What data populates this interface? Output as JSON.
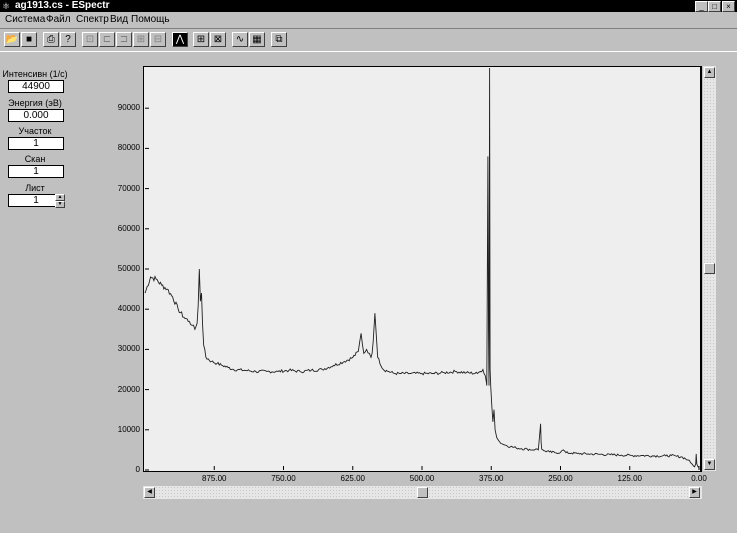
{
  "window": {
    "title": "ag1913.cs - ESpectr"
  },
  "menu": [
    "Система",
    "Файл",
    "Спектр",
    "Вид",
    "Помощь"
  ],
  "fields": {
    "intensity_label": "Интенсивн (1/с)",
    "intensity_value": "44900",
    "energy_label": "Энергия (эВ)",
    "energy_value": "0.000",
    "region_label": "Участок",
    "region_value": "1",
    "scan_label": "Скан",
    "scan_value": "1",
    "sheet_label": "Лист",
    "sheet_value": "1"
  },
  "icons": {
    "toolbar": [
      "open-folder-icon",
      "save-icon",
      "print-icon",
      "help-icon",
      "tool-1-icon",
      "tool-2-icon",
      "tool-3-icon",
      "tool-4-icon",
      "tool-5-icon",
      "peak-icon",
      "grid-icon",
      "grid-zoom-icon",
      "spectrum-icon",
      "spectrum-grid-icon",
      "export-icon"
    ]
  },
  "colors": {
    "plot_bg": "#eeeeee",
    "line": "#202020",
    "window_bg": "#c0c0c0"
  },
  "chart_data": {
    "type": "line",
    "title": "",
    "xlabel": "",
    "ylabel": "",
    "xlim": [
      1000,
      0
    ],
    "ylim": [
      0,
      100000
    ],
    "x_reversed": true,
    "x_ticks": [
      875,
      750,
      625,
      500,
      375,
      250,
      125,
      0
    ],
    "x_tick_labels": [
      "875.00",
      "750.00",
      "625.00",
      "500.00",
      "375.00",
      "250.00",
      "125.00",
      "0.00"
    ],
    "y_ticks": [
      0,
      10000,
      20000,
      30000,
      40000,
      50000,
      60000,
      70000,
      80000,
      90000
    ],
    "y_tick_labels": [
      "0",
      "10000",
      "20000",
      "30000",
      "40000",
      "50000",
      "60000",
      "70000",
      "80000",
      "90000"
    ],
    "series": [
      {
        "x": [
          1000,
          990,
          980,
          970,
          960,
          950,
          940,
          930,
          920,
          915,
          910,
          906,
          904,
          902,
          900,
          898,
          896,
          894,
          892,
          890,
          880,
          870,
          860,
          850,
          840,
          820,
          800,
          780,
          760,
          740,
          720,
          700,
          680,
          660,
          640,
          625,
          615,
          610,
          605,
          600,
          595,
          592,
          590,
          588,
          585,
          580,
          570,
          560,
          550,
          540,
          520,
          500,
          480,
          460,
          440,
          420,
          400,
          395,
          390,
          386,
          384,
          383,
          382,
          381,
          380,
          379,
          378,
          377,
          376,
          374,
          372,
          370,
          368,
          365,
          360,
          355,
          350,
          340,
          330,
          320,
          310,
          300,
          295,
          290,
          288,
          286,
          285,
          284,
          282,
          280,
          270,
          260,
          250,
          245,
          240,
          230,
          220,
          200,
          180,
          160,
          140,
          120,
          100,
          80,
          60,
          50,
          40,
          30,
          20,
          15,
          10,
          8,
          6,
          5,
          4,
          2,
          0
        ],
        "y": [
          44000,
          48000,
          47500,
          46000,
          45000,
          43000,
          40000,
          38000,
          37000,
          36000,
          35000,
          36500,
          41000,
          50000,
          42000,
          44000,
          36000,
          31000,
          30000,
          28000,
          27000,
          26500,
          26000,
          25500,
          25000,
          24800,
          24500,
          24500,
          24500,
          24800,
          24500,
          24800,
          25000,
          26000,
          27000,
          28000,
          29500,
          34000,
          29000,
          30000,
          29000,
          28000,
          29000,
          32000,
          39000,
          28000,
          25000,
          24500,
          24000,
          24000,
          24000,
          24000,
          24000,
          24200,
          24500,
          24200,
          24000,
          24500,
          25000,
          23500,
          22000,
          21000,
          52000,
          78000,
          35000,
          21000,
          100000,
          25000,
          21000,
          16000,
          12000,
          15000,
          10000,
          8000,
          7000,
          6500,
          6200,
          5800,
          5500,
          5300,
          5200,
          5000,
          5200,
          5000,
          8000,
          11500,
          7000,
          5200,
          5000,
          4800,
          4500,
          4300,
          4400,
          5000,
          4300,
          4200,
          4100,
          4000,
          3900,
          3800,
          3700,
          3600,
          3600,
          3500,
          3500,
          3600,
          3400,
          3200,
          2500,
          1800,
          1000,
          800,
          1500,
          4000,
          1500,
          900,
          500
        ]
      }
    ]
  }
}
